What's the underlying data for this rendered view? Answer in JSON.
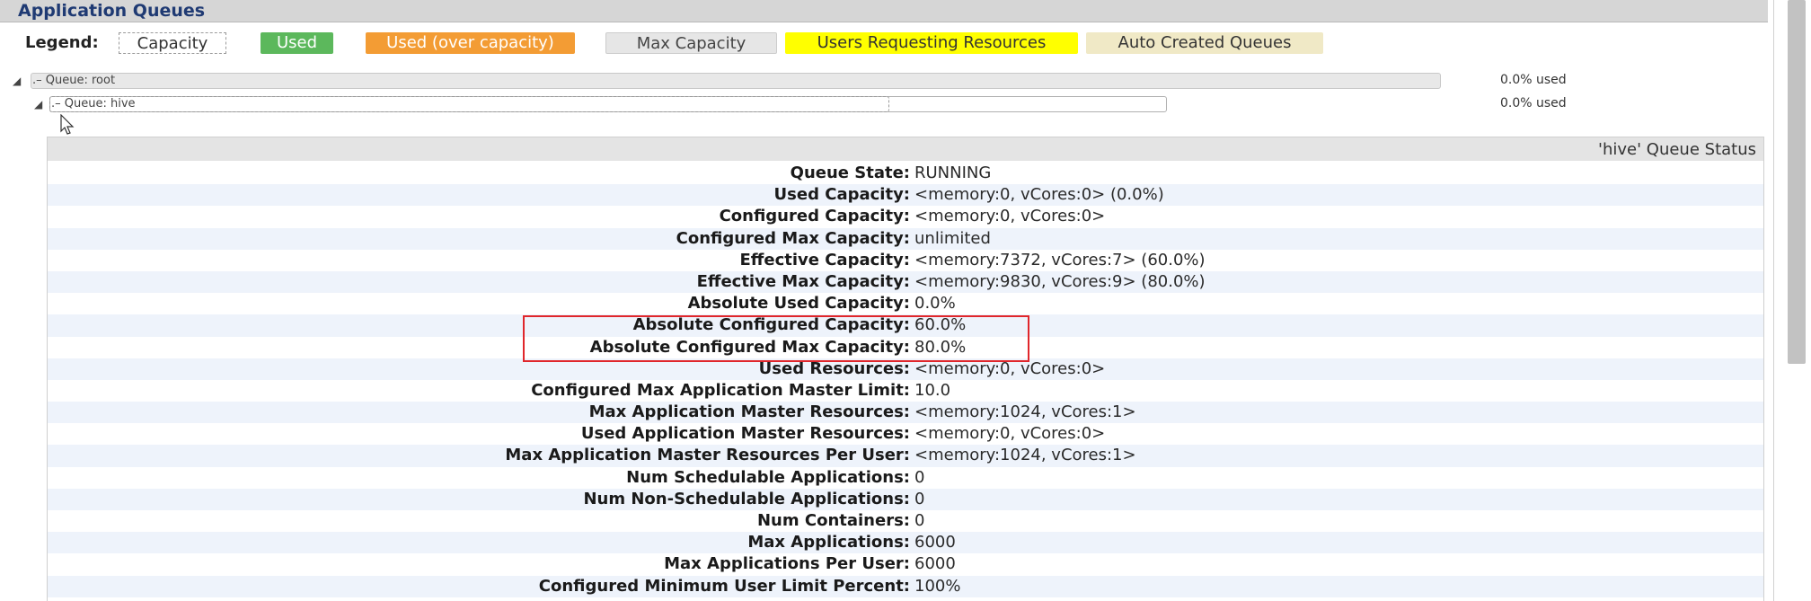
{
  "header": {
    "title": "Application Queues"
  },
  "legend": {
    "label": "Legend:",
    "items": [
      {
        "label": "Capacity"
      },
      {
        "label": "Used",
        "color": "#5cb85c"
      },
      {
        "label": "Used (over capacity)",
        "color": "#f39c34"
      },
      {
        "label": "Max Capacity",
        "color": "#e6e6e6"
      },
      {
        "label": "Users Requesting Resources",
        "color": "#ffff00"
      },
      {
        "label": "Auto Created Queues",
        "color": "#f0e9c6"
      }
    ]
  },
  "queues": {
    "root": {
      "label": "Queue: root",
      "toggle": ".–",
      "used": "0.0% used"
    },
    "hive": {
      "label": "Queue: hive",
      "toggle": ".–",
      "used": "0.0% used"
    }
  },
  "status": {
    "title": "'hive' Queue Status",
    "rows": [
      {
        "key": "Queue State:",
        "value": "RUNNING"
      },
      {
        "key": "Used Capacity:",
        "value": "<memory:0, vCores:0> (0.0%)"
      },
      {
        "key": "Configured Capacity:",
        "value": "<memory:0, vCores:0>"
      },
      {
        "key": "Configured Max Capacity:",
        "value": "unlimited"
      },
      {
        "key": "Effective Capacity:",
        "value": "<memory:7372, vCores:7> (60.0%)"
      },
      {
        "key": "Effective Max Capacity:",
        "value": "<memory:9830, vCores:9> (80.0%)"
      },
      {
        "key": "Absolute Used Capacity:",
        "value": "0.0%"
      },
      {
        "key": "Absolute Configured Capacity:",
        "value": "60.0%"
      },
      {
        "key": "Absolute Configured Max Capacity:",
        "value": "80.0%"
      },
      {
        "key": "Used Resources:",
        "value": "<memory:0, vCores:0>"
      },
      {
        "key": "Configured Max Application Master Limit:",
        "value": "10.0"
      },
      {
        "key": "Max Application Master Resources:",
        "value": "<memory:1024, vCores:1>"
      },
      {
        "key": "Used Application Master Resources:",
        "value": "<memory:0, vCores:0>"
      },
      {
        "key": "Max Application Master Resources Per User:",
        "value": "<memory:1024, vCores:1>"
      },
      {
        "key": "Num Schedulable Applications:",
        "value": "0"
      },
      {
        "key": "Num Non-Schedulable Applications:",
        "value": "0"
      },
      {
        "key": "Num Containers:",
        "value": "0"
      },
      {
        "key": "Max Applications:",
        "value": "6000"
      },
      {
        "key": "Max Applications Per User:",
        "value": "6000"
      },
      {
        "key": "Configured Minimum User Limit Percent:",
        "value": "100%"
      }
    ]
  },
  "colors": {
    "highlight": "#e0262b",
    "title": "#1f3a73"
  }
}
